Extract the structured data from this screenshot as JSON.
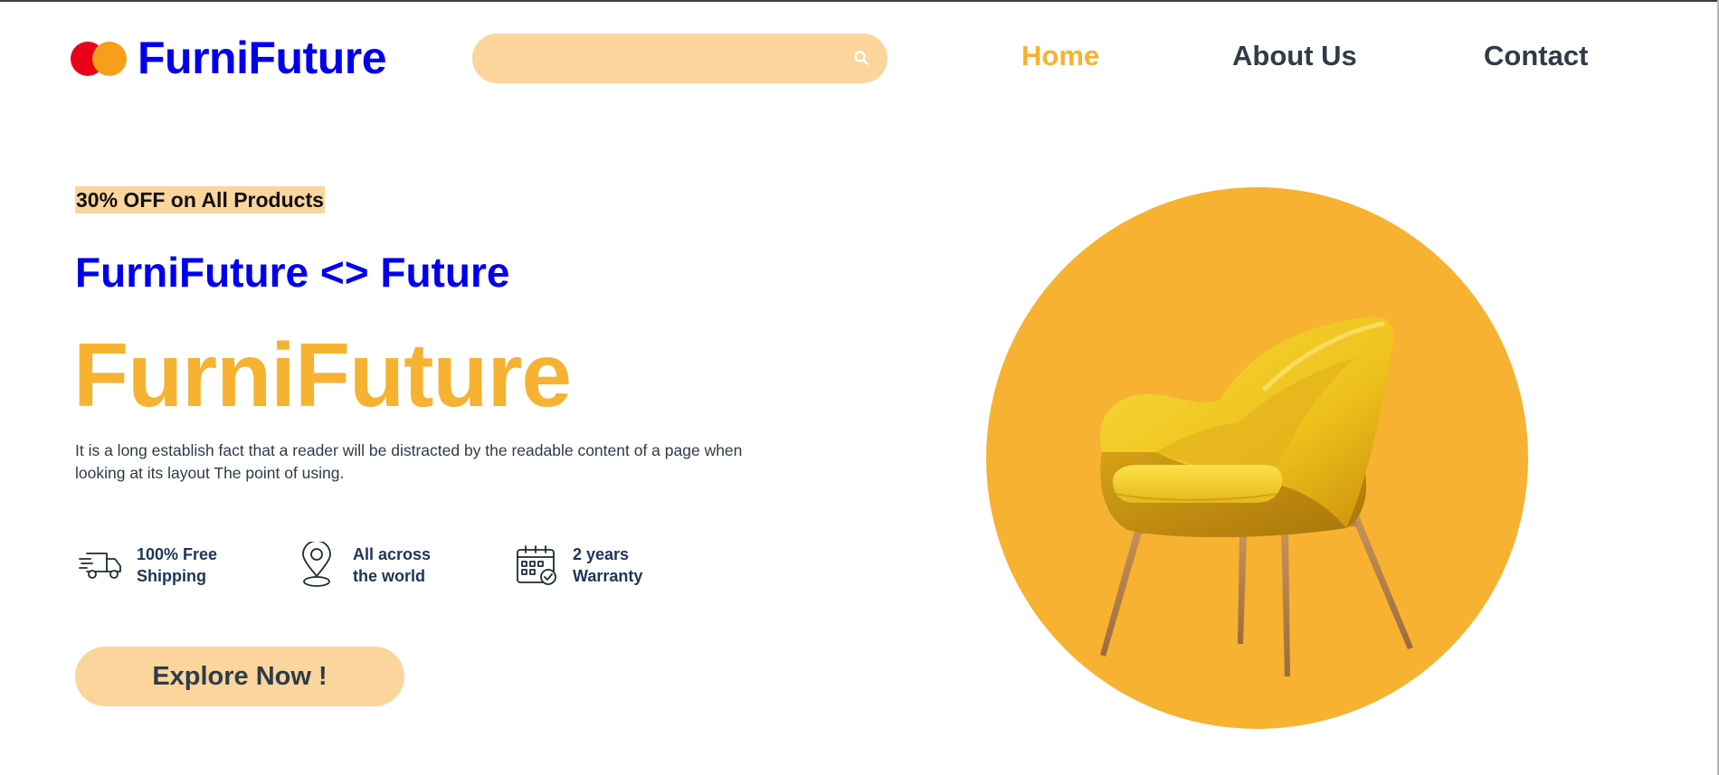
{
  "header": {
    "brand": "FurniFuture",
    "search": {
      "placeholder": "",
      "value": ""
    },
    "nav": [
      {
        "label": "Home",
        "active": true
      },
      {
        "label": "About Us",
        "active": false
      },
      {
        "label": "Contact",
        "active": false
      }
    ]
  },
  "hero": {
    "promo": "30% OFF on All Products",
    "subtitle": "FurniFuture <> Future",
    "title": "FurniFuture",
    "description": "It is a long establish fact that a reader will be distracted by the readable content of a page when looking at its layout The point of using.",
    "features": [
      {
        "line1": "100% Free",
        "line2": "Shipping",
        "icon": "delivery-truck-icon"
      },
      {
        "line1": "All across",
        "line2": "the world",
        "icon": "location-pin-icon"
      },
      {
        "line1": "2 years",
        "line2": "Warranty",
        "icon": "calendar-check-icon"
      }
    ],
    "cta_label": "Explore Now !"
  },
  "colors": {
    "brand_blue": "#0000ee",
    "accent_orange": "#f6b230",
    "soft_peach": "#fbd59c",
    "text_dark": "#2f3b48"
  }
}
